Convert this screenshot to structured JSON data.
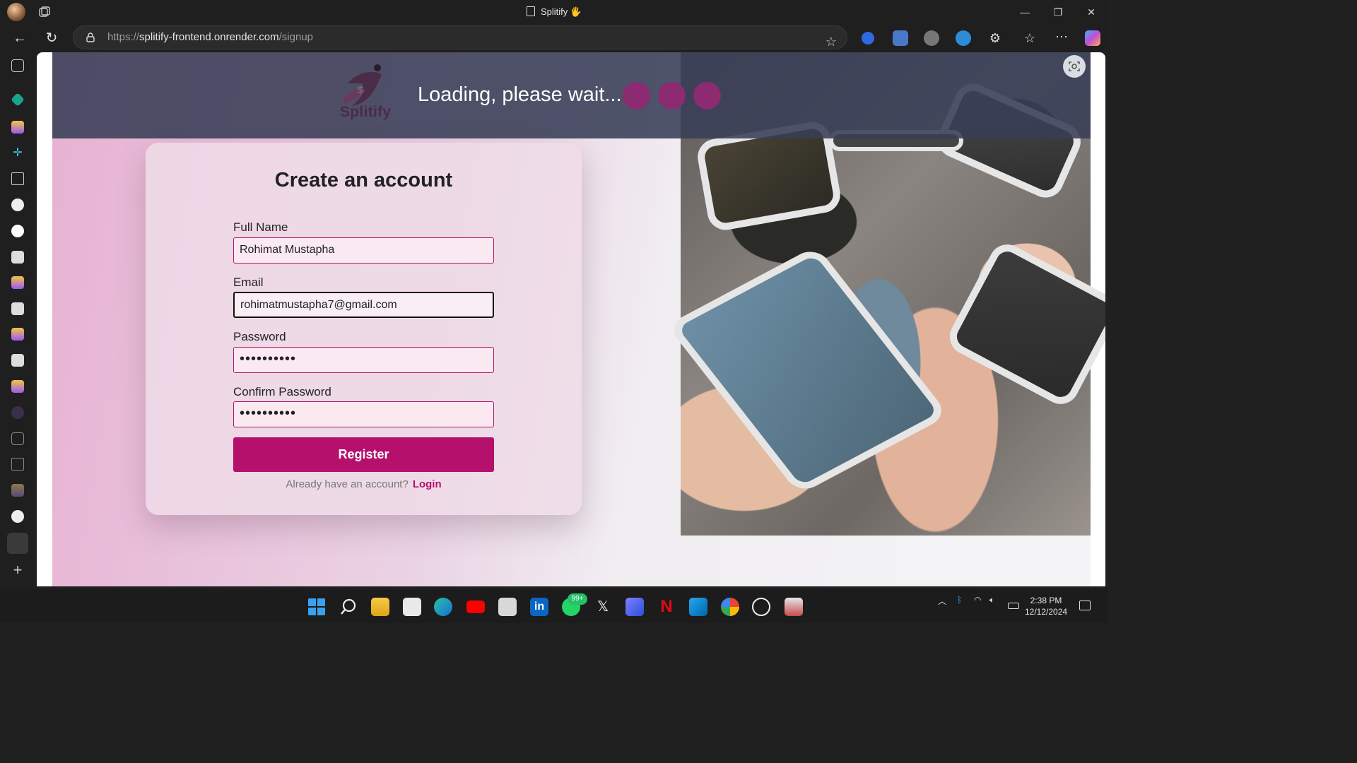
{
  "browser": {
    "tab_title": "Splitify 🖐",
    "url_prefix": "https://",
    "url_host": "splitify-frontend.onrender.com",
    "url_path": "/signup"
  },
  "header": {
    "brand": "Splitify",
    "loading_text": "Loading, please wait..."
  },
  "form": {
    "title": "Create an account",
    "full_name_label": "Full Name",
    "full_name_value": "Rohimat Mustapha",
    "email_label": "Email",
    "email_value": "rohimatmustapha7@gmail.com",
    "password_label": "Password",
    "password_value": "••••••••••",
    "confirm_label": "Confirm Password",
    "confirm_value": "••••••••••",
    "register_label": "Register",
    "already_text": "Already have an account?",
    "login_link": "Login"
  },
  "taskbar": {
    "whatsapp_badge": "99+",
    "time": "2:38 PM",
    "date": "12/12/2024"
  },
  "colors": {
    "accent": "#b5106c",
    "loading_dot": "#8c2a72",
    "header_overlay": "#383e56"
  }
}
